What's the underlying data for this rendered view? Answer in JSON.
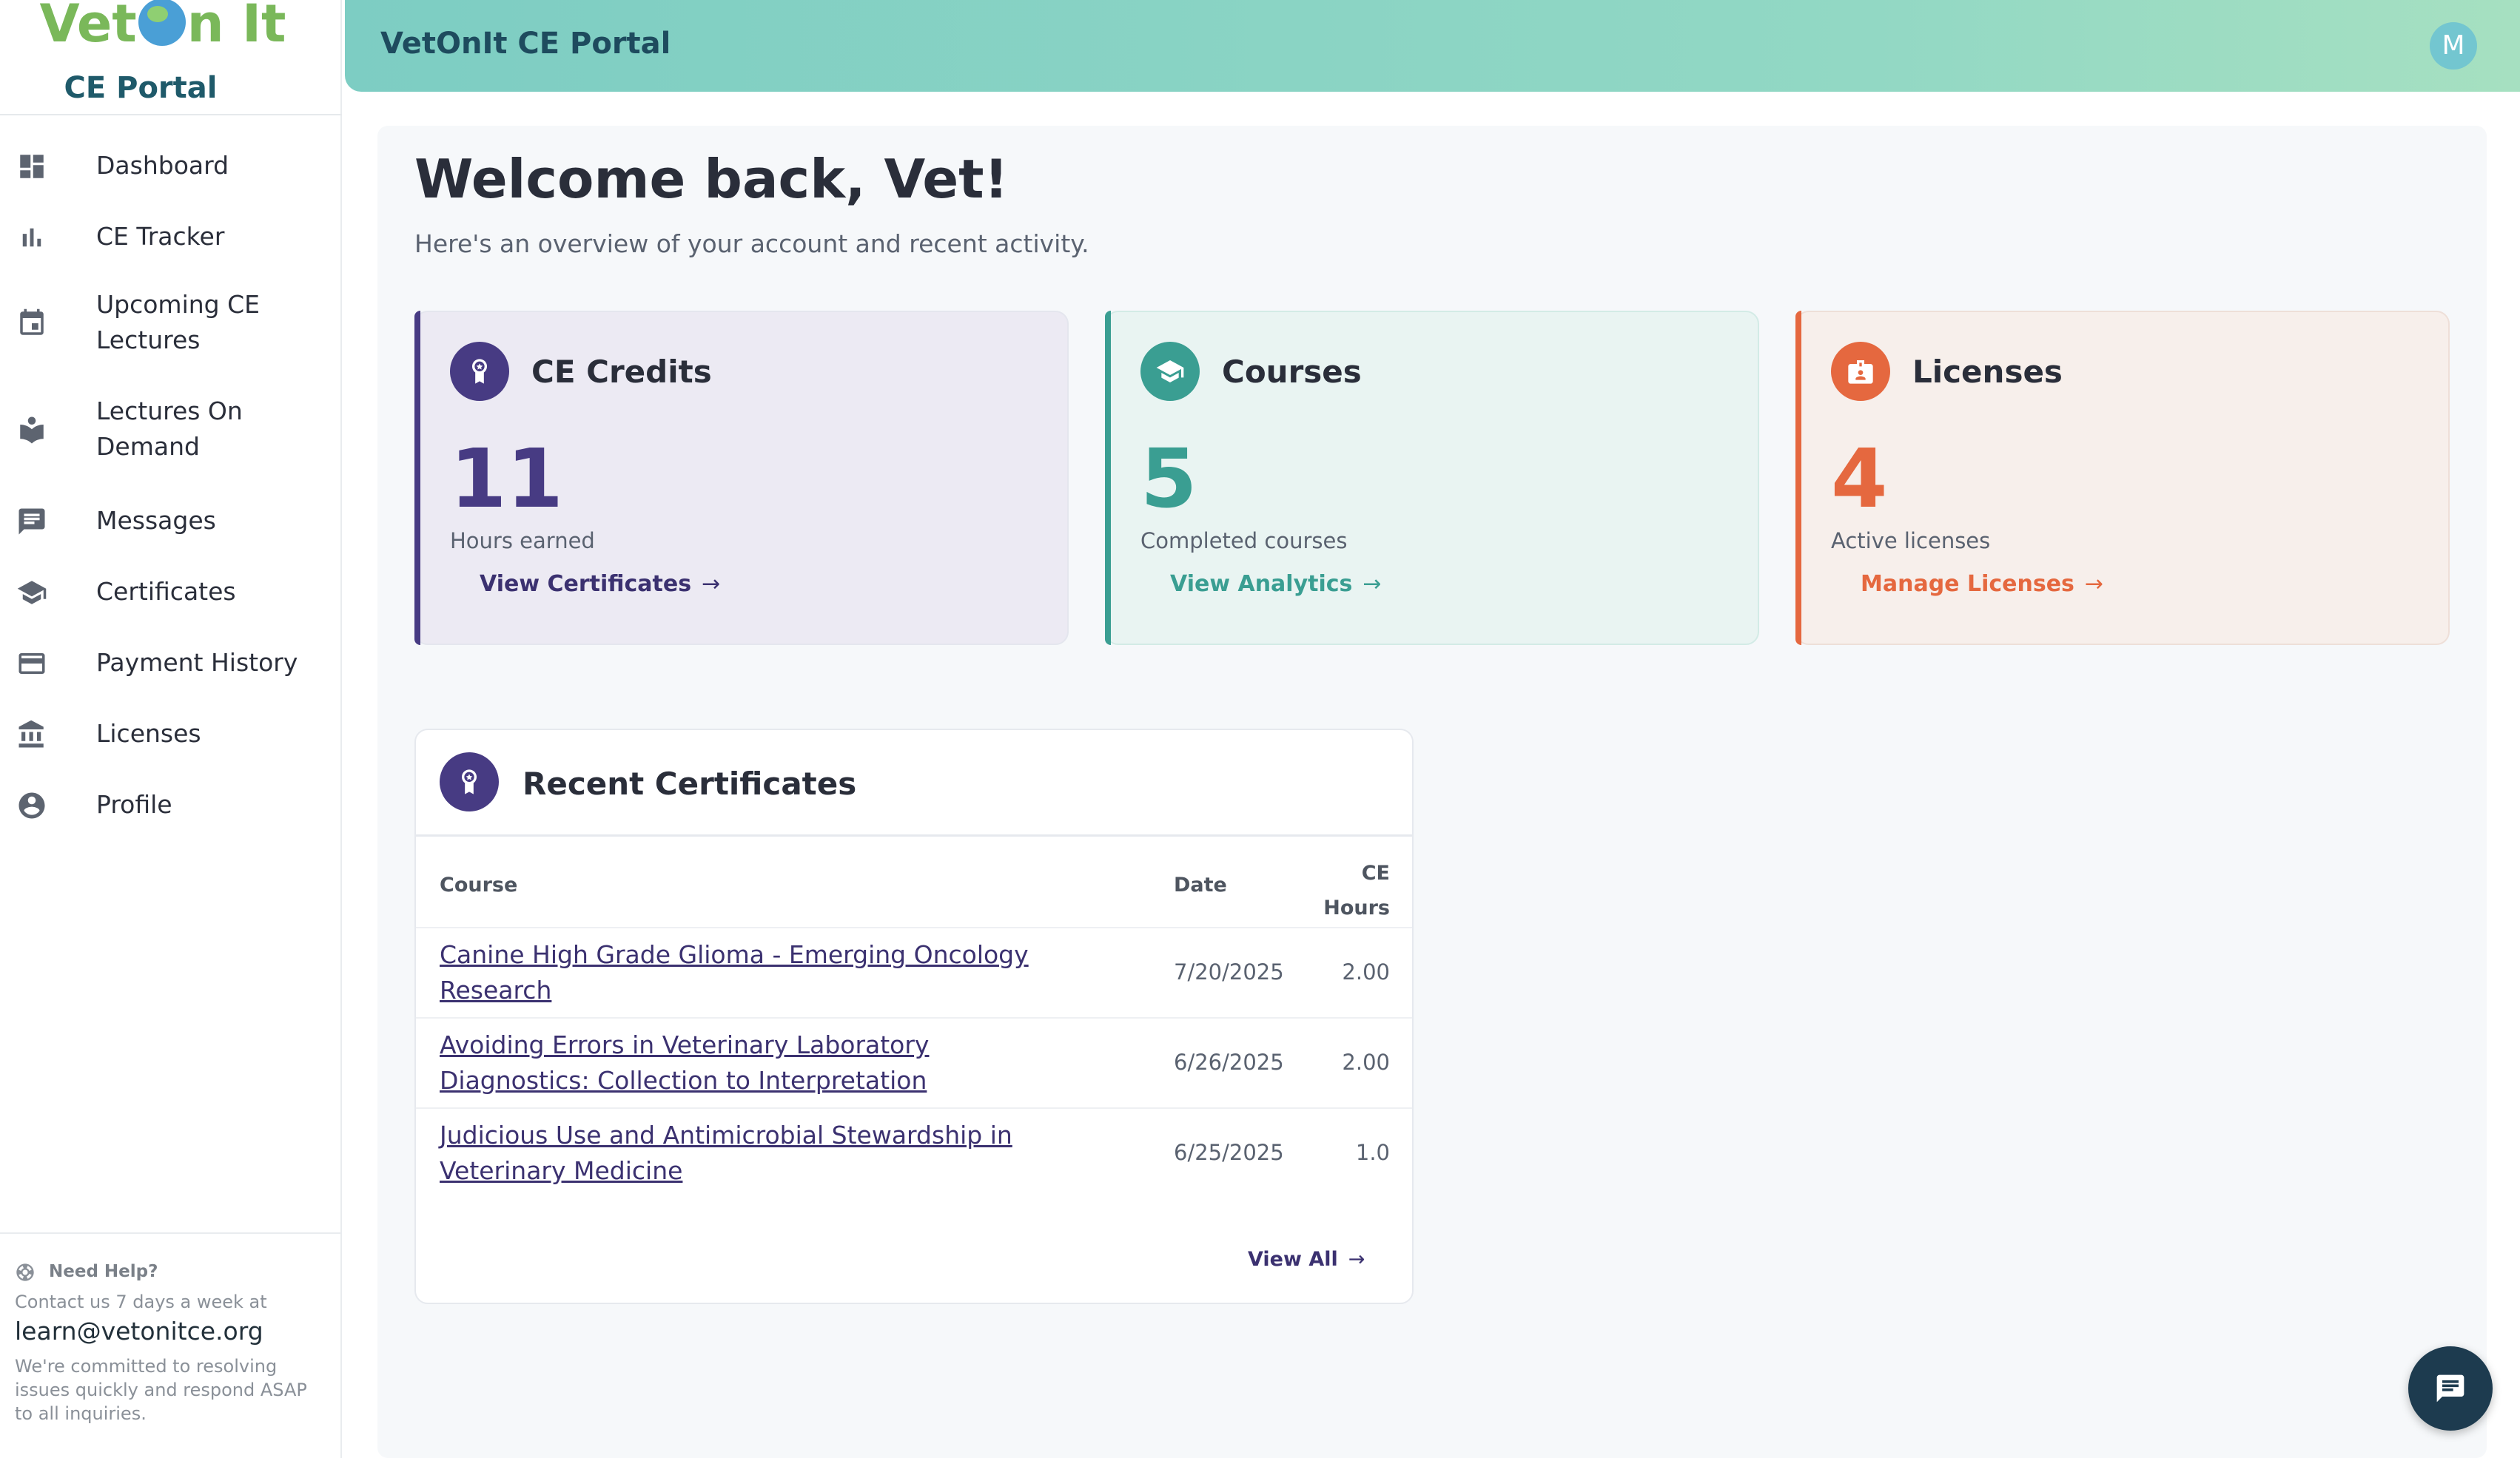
{
  "logo": {
    "text_left": "Vet",
    "text_right": "n It",
    "subtitle": "CE Portal"
  },
  "header": {
    "title": "VetOnIt CE Portal",
    "avatar_initial": "M"
  },
  "sidebar": {
    "items": [
      {
        "label": "Dashboard",
        "icon": "dashboard-icon"
      },
      {
        "label": "CE Tracker",
        "icon": "bar-chart-icon"
      },
      {
        "label": "Upcoming CE Lectures",
        "icon": "calendar-icon"
      },
      {
        "label": "Lectures On Demand",
        "icon": "book-reader-icon"
      },
      {
        "label": "Messages",
        "icon": "message-icon"
      },
      {
        "label": "Certificates",
        "icon": "graduation-cap-icon"
      },
      {
        "label": "Payment History",
        "icon": "credit-card-icon"
      },
      {
        "label": "Licenses",
        "icon": "bank-icon"
      },
      {
        "label": "Profile",
        "icon": "account-circle-icon"
      }
    ],
    "help": {
      "title": "Need Help?",
      "contact": "Contact us 7 days a week at",
      "email": "learn@vetonitce.org",
      "note": "We're committed to resolving issues quickly and respond ASAP to all inquiries."
    }
  },
  "main": {
    "welcome": "Welcome back, Vet!",
    "overview": "Here's an overview of your account and recent activity.",
    "stats": [
      {
        "title": "CE Credits",
        "value": "11",
        "label": "Hours earned",
        "link": "View Certificates",
        "accent": "#473b83",
        "bg": "#eceaf3"
      },
      {
        "title": "Courses",
        "value": "5",
        "label": "Completed courses",
        "link": "View Analytics",
        "accent": "#3a9e92",
        "bg": "#e9f4f2"
      },
      {
        "title": "Licenses",
        "value": "4",
        "label": "Active licenses",
        "link": "Manage Licenses",
        "accent": "#e5683f",
        "bg": "#f7efeb"
      }
    ],
    "recent": {
      "title": "Recent Certificates",
      "columns": {
        "course": "Course",
        "date": "Date",
        "hours_line1": "CE",
        "hours_line2": "Hours"
      },
      "rows": [
        {
          "course": "Canine High Grade Glioma - Emerging Oncology Research",
          "date": "7/20/2025",
          "hours": "2.00"
        },
        {
          "course": "Avoiding Errors in Veterinary Laboratory Diagnostics: Collection to Interpretation",
          "date": "6/26/2025",
          "hours": "2.00"
        },
        {
          "course": "Judicious Use and Antimicrobial Stewardship in Veterinary Medicine",
          "date": "6/25/2025",
          "hours": "1.0"
        }
      ],
      "view_all": "View All"
    }
  },
  "colors": {
    "header_gradient_start": "#7dcdc3",
    "header_gradient_end": "#a6e0c1",
    "primary": "#473b83",
    "teal": "#3a9e92",
    "orange": "#e5683f",
    "chat_button": "#1d3b4f"
  }
}
